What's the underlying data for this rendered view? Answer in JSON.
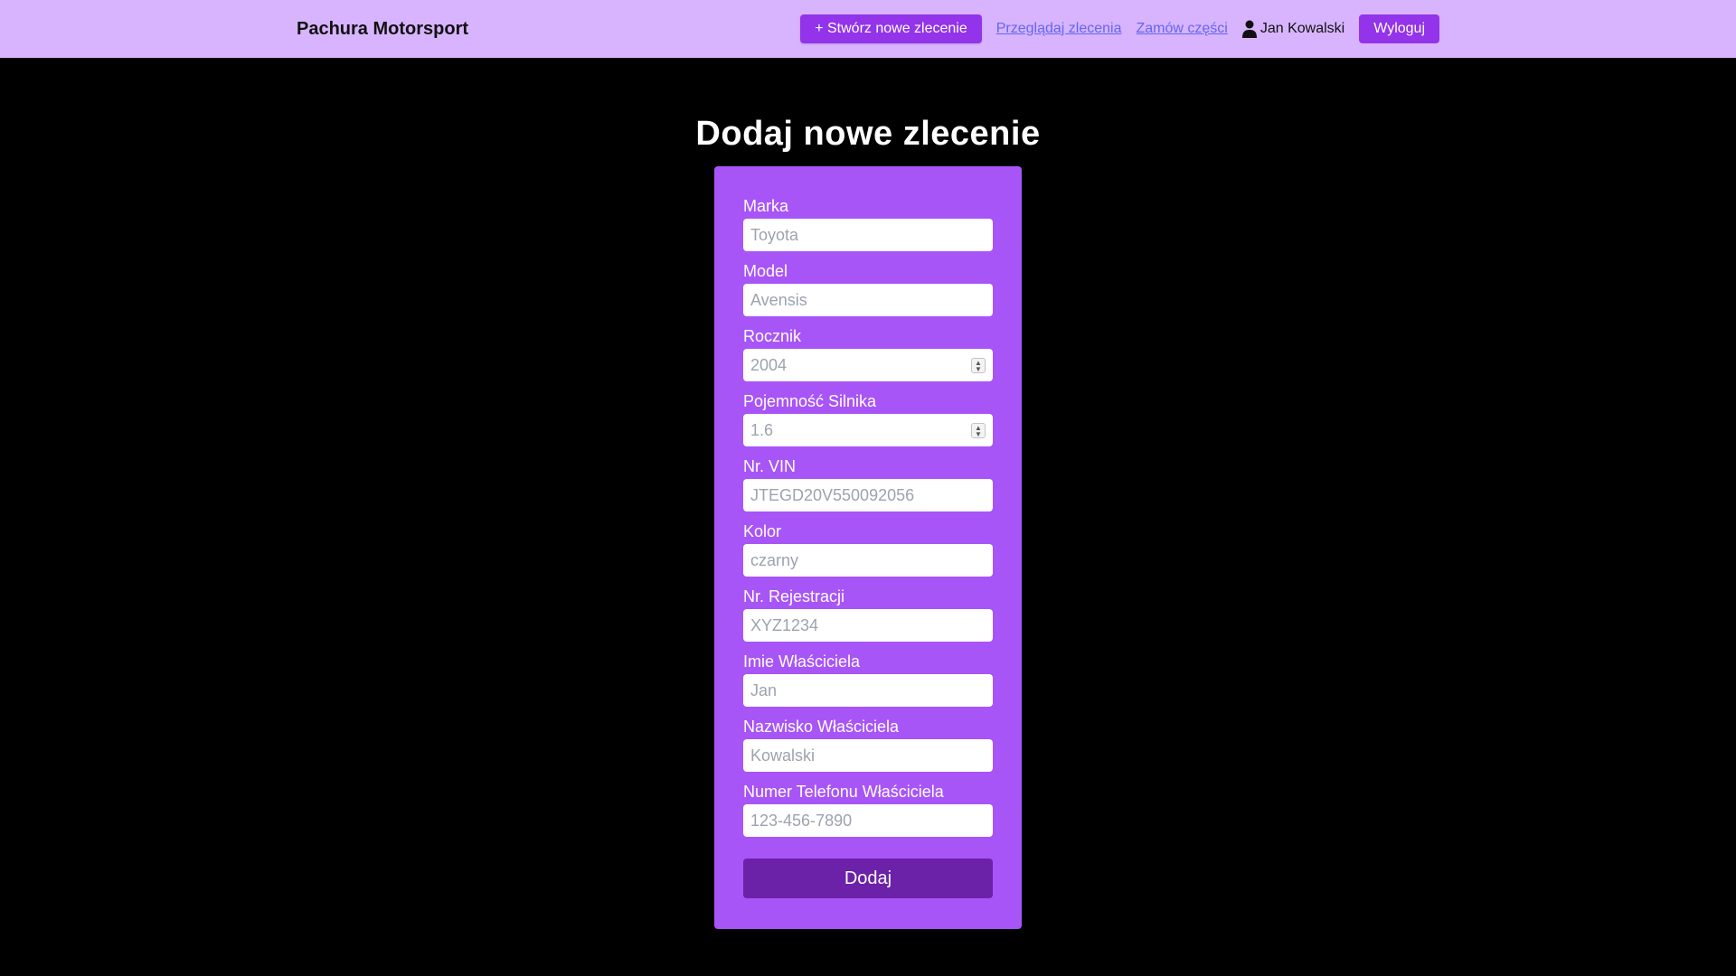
{
  "nav": {
    "brand": "Pachura Motorsport",
    "create_button": "+ Stwórz nowe zlecenie",
    "browse_link": "Przeglądaj zlecenia",
    "parts_link": "Zamów części",
    "user_name": "Jan Kowalski",
    "user_icon": "user-icon",
    "logout_button": "Wyloguj"
  },
  "page": {
    "title": "Dodaj nowe zlecenie"
  },
  "form": {
    "fields": [
      {
        "label": "Marka",
        "placeholder": "Toyota",
        "type": "text"
      },
      {
        "label": "Model",
        "placeholder": "Avensis",
        "type": "text"
      },
      {
        "label": "Rocznik",
        "placeholder": "2004",
        "type": "number"
      },
      {
        "label": "Pojemność Silnika",
        "placeholder": "1.6",
        "type": "number"
      },
      {
        "label": "Nr. VIN",
        "placeholder": "JTEGD20V550092056",
        "type": "text"
      },
      {
        "label": "Kolor",
        "placeholder": "czarny",
        "type": "text"
      },
      {
        "label": "Nr. Rejestracji",
        "placeholder": "XYZ1234",
        "type": "text"
      },
      {
        "label": "Imie Właściciela",
        "placeholder": "Jan",
        "type": "text"
      },
      {
        "label": "Nazwisko Właściciela",
        "placeholder": "Kowalski",
        "type": "text"
      },
      {
        "label": "Numer Telefonu Właściciela",
        "placeholder": "123-456-7890",
        "type": "text"
      }
    ],
    "submit_button": "Dodaj"
  },
  "colors": {
    "navbar_bg": "#d8b4fe",
    "accent": "#9333ea",
    "card_bg": "#a855f7",
    "submit_bg": "#6b21a8",
    "link": "#6366f1",
    "page_bg": "#000000"
  }
}
